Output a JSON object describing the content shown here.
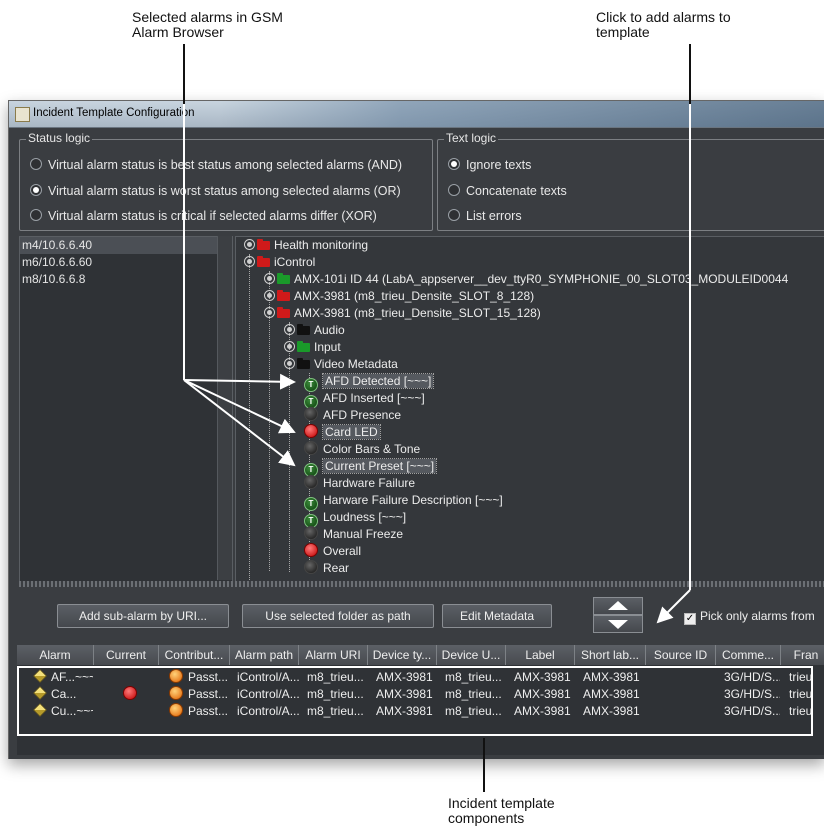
{
  "callouts": {
    "top_left": "Selected alarms in GSM\nAlarm Browser",
    "top_right": "Click to add alarms to\ntemplate",
    "bottom": "Incident template\ncomponents"
  },
  "window": {
    "title": "Incident Template Configuration"
  },
  "status_logic": {
    "legend": "Status logic",
    "options": [
      {
        "label": "Virtual alarm status is best status among selected alarms (AND)",
        "selected": false
      },
      {
        "label": "Virtual alarm status is worst status among selected alarms (OR)",
        "selected": true
      },
      {
        "label": "Virtual alarm status is critical if selected alarms differ (XOR)",
        "selected": false
      }
    ]
  },
  "text_logic": {
    "legend": "Text logic",
    "options": [
      {
        "label": "Ignore texts",
        "selected": true
      },
      {
        "label": "Concatenate texts",
        "selected": false
      },
      {
        "label": "List errors",
        "selected": false
      }
    ]
  },
  "hosts": [
    "m4/10.6.6.40",
    "m6/10.6.6.60",
    "m8/10.6.6.8"
  ],
  "tree": {
    "health": "Health monitoring",
    "icontrol": "iControl",
    "amx101": "AMX-101i ID 44 (LabA_appserver__dev_ttyR0_SYMPHONIE_00_SLOT03_MODULEID0044",
    "amx3981_8": "AMX-3981 (m8_trieu_Densite_SLOT_8_128)",
    "amx3981_15": "AMX-3981 (m8_trieu_Densite_SLOT_15_128)",
    "audio": "Audio",
    "input": "Input",
    "video_metadata": "Video Metadata",
    "alarms": [
      {
        "label": "AFD Detected [~~~]",
        "icon": "t",
        "highlight": true
      },
      {
        "label": "AFD Inserted [~~~]",
        "icon": "t",
        "highlight": false
      },
      {
        "label": "AFD Presence",
        "icon": "blk",
        "highlight": false
      },
      {
        "label": "Card LED",
        "icon": "red",
        "highlight": true
      },
      {
        "label": "Color Bars & Tone",
        "icon": "blk",
        "highlight": false
      },
      {
        "label": "Current Preset [~~~]",
        "icon": "t",
        "highlight": true
      },
      {
        "label": "Hardware Failure",
        "icon": "blk",
        "highlight": false
      },
      {
        "label": "Harware Failure Description [~~~]",
        "icon": "t",
        "highlight": false
      },
      {
        "label": "Loudness [~~~]",
        "icon": "t",
        "highlight": false
      },
      {
        "label": "Manual Freeze",
        "icon": "blk",
        "highlight": false
      },
      {
        "label": "Overall",
        "icon": "red",
        "highlight": false
      },
      {
        "label": "Rear",
        "icon": "blk",
        "highlight": false
      }
    ]
  },
  "toolbar": {
    "add_sub_alarm": "Add sub-alarm by URI...",
    "use_folder": "Use selected folder as path",
    "edit_metadata": "Edit Metadata",
    "pick_only": "Pick only alarms from"
  },
  "table": {
    "headers": [
      "Alarm",
      "Current",
      "Contribut...",
      "Alarm path",
      "Alarm URI",
      "Device ty...",
      "Device U...",
      "Label",
      "Short lab...",
      "Source ID",
      "Comme...",
      "Fran"
    ],
    "rows": [
      {
        "alarm": "AF...~~~",
        "current": "",
        "contrib": "Passt...",
        "path": "iControl/A...",
        "uri": "m8_trieu...",
        "devtype": "AMX-3981",
        "devu": "m8_trieu...",
        "label": "AMX-3981",
        "short": "AMX-3981",
        "source": "",
        "comment": "3G/HD/S...",
        "frame": "trieu"
      },
      {
        "alarm": "Ca...",
        "current": "red",
        "contrib": "Passt...",
        "path": "iControl/A...",
        "uri": "m8_trieu...",
        "devtype": "AMX-3981",
        "devu": "m8_trieu...",
        "label": "AMX-3981",
        "short": "AMX-3981",
        "source": "",
        "comment": "3G/HD/S...",
        "frame": "trieu"
      },
      {
        "alarm": "Cu...~~~",
        "current": "",
        "contrib": "Passt...",
        "path": "iControl/A...",
        "uri": "m8_trieu...",
        "devtype": "AMX-3981",
        "devu": "m8_trieu...",
        "label": "AMX-3981",
        "short": "AMX-3981",
        "source": "",
        "comment": "3G/HD/S...",
        "frame": "trieu"
      }
    ]
  }
}
